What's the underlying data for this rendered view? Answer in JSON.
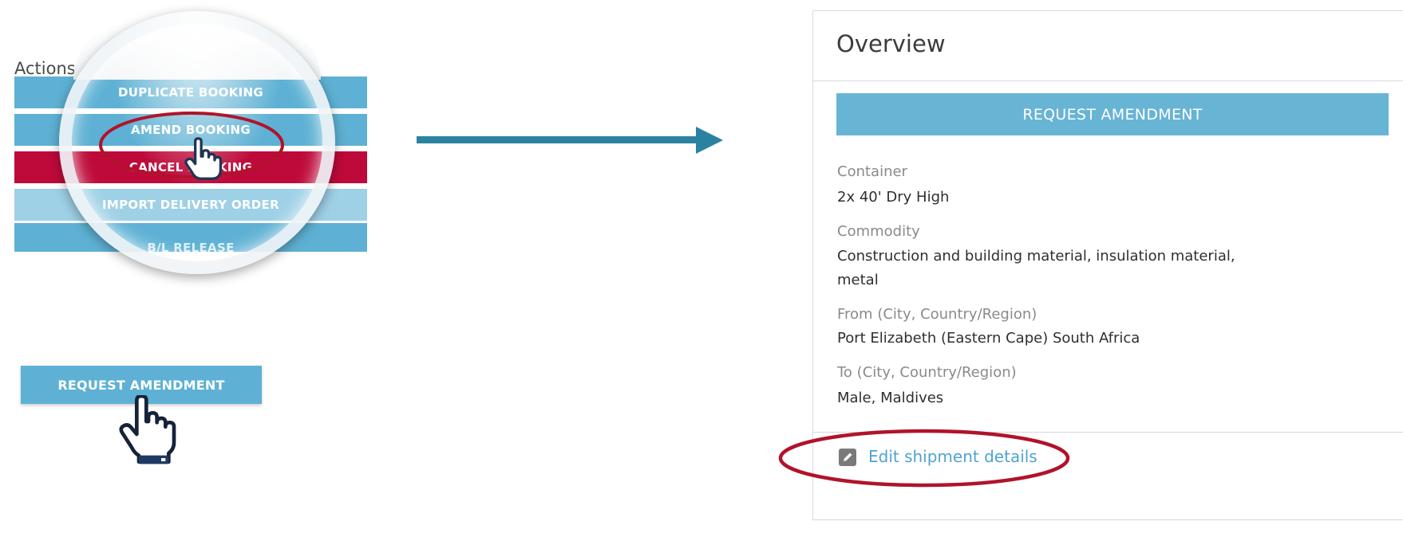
{
  "actions": {
    "title": "Actions",
    "buttons": [
      {
        "label": "DUPLICATE BOOKING"
      },
      {
        "label": "AMEND BOOKING"
      },
      {
        "label": "CANCEL BOOKING"
      },
      {
        "label": "IMPORT DELIVERY ORDER"
      },
      {
        "label": "B/L RELEASE"
      }
    ]
  },
  "left_request_button": {
    "label": "REQUEST AMENDMENT"
  },
  "overview": {
    "title": "Overview",
    "request_button": "REQUEST AMENDMENT",
    "fields": [
      {
        "label": "Container",
        "value": "2x 40' Dry High"
      },
      {
        "label": "Commodity",
        "value_line1": "Construction and building material, insulation material,",
        "value_line2": "metal"
      },
      {
        "label": "From (City, Country/Region)",
        "value": "Port Elizabeth (Eastern Cape) South Africa"
      },
      {
        "label": "To (City, Country/Region)",
        "value": "Male, Maldives"
      }
    ],
    "edit_link": "Edit shipment details"
  },
  "colors": {
    "button_blue": "#5eb1d4",
    "button_red": "#be0a3a",
    "highlight_ring": "#b0132b",
    "arrow": "#2b82a0",
    "link": "#4fa3cf"
  },
  "icons": [
    "hand-pointer-icon",
    "edit-icon",
    "arrow-right-icon"
  ]
}
